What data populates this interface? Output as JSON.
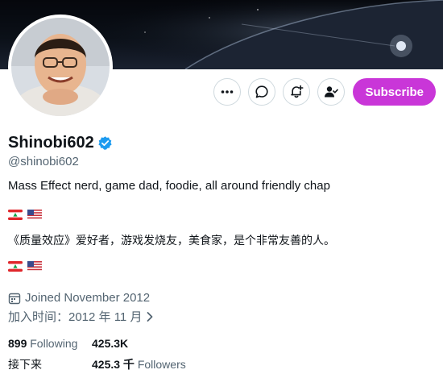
{
  "profile": {
    "display_name": "Shinobi602",
    "handle": "@shinobi602",
    "verified": true,
    "bio": "Mass Effect nerd, game dad, foodie, all around friendly chap",
    "bio_translated": "《质量效应》爱好者，游戏发烧友，美食家，是个非常友善的人。",
    "flags": [
      "lebanon-flag",
      "usa-flag"
    ],
    "joined": "Joined November 2012",
    "joined_translated": "加入时间：2012 年 11 月"
  },
  "actions": {
    "subscribe_label": "Subscribe",
    "icons": [
      "more-icon",
      "message-icon",
      "notification-bell-icon",
      "follow-person-icon"
    ]
  },
  "stats": {
    "following_count": "899",
    "following_label": "Following",
    "followers_count": "425.3K",
    "following_label_translated": "接下来",
    "followers_count_translated": "425.3 千",
    "followers_label": "Followers"
  },
  "colors": {
    "subscribe_bg": "#c936d8",
    "verified_badge": "#1d9bf0",
    "secondary_text": "#536471"
  }
}
